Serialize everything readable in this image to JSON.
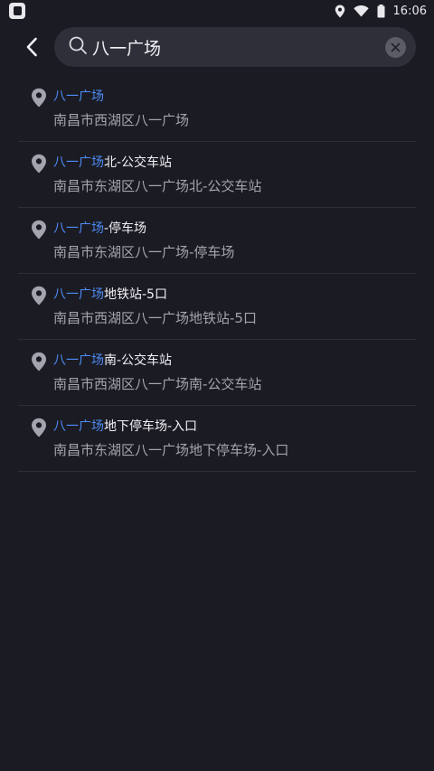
{
  "status_bar": {
    "time": "16:06",
    "icons": [
      "app-badge-icon",
      "location-icon",
      "wifi-icon",
      "battery-icon"
    ]
  },
  "search": {
    "value": "八一广场",
    "placeholder": "",
    "icons": [
      "back-arrow-icon",
      "search-icon",
      "clear-icon"
    ]
  },
  "results": [
    {
      "highlight": "八一广场",
      "rest": "",
      "address": "南昌市西湖区八一广场"
    },
    {
      "highlight": "八一广场",
      "rest": "北-公交车站",
      "address": "南昌市东湖区八一广场北-公交车站"
    },
    {
      "highlight": "八一广场",
      "rest": "-停车场",
      "address": "南昌市东湖区八一广场-停车场"
    },
    {
      "highlight": "八一广场",
      "rest": "地铁站-5口",
      "address": "南昌市西湖区八一广场地铁站-5口"
    },
    {
      "highlight": "八一广场",
      "rest": "南-公交车站",
      "address": "南昌市西湖区八一广场南-公交车站"
    },
    {
      "highlight": "八一广场",
      "rest": "地下停车场-入口",
      "address": "南昌市东湖区八一广场地下停车场-入口"
    }
  ],
  "colors": {
    "background": "#1b1b23",
    "search_box": "#2e2f39",
    "highlight": "#4d8cf5",
    "title": "#f2f2f5",
    "address": "#a3a4ad",
    "divider": "#2d2e37"
  }
}
